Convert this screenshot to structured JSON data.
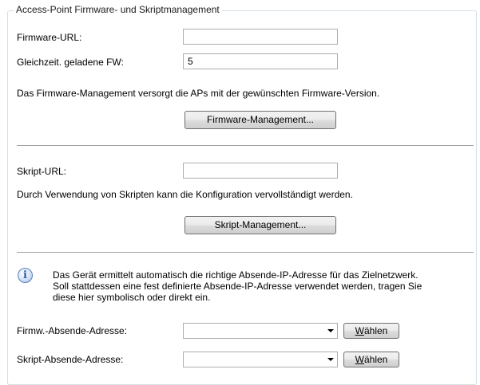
{
  "group": {
    "title": "Access-Point Firmware- und Skriptmanagement"
  },
  "firmware": {
    "url_label": "Firmware-URL:",
    "url_value": "",
    "concurrent_label": "Gleichzeit. geladene FW:",
    "concurrent_value": "5",
    "description": "Das Firmware-Management versorgt die APs mit der gewünschten Firmware-Version.",
    "button_label": "Firmware-Management..."
  },
  "script": {
    "url_label": "Skript-URL:",
    "url_value": "",
    "description": "Durch Verwendung von Skripten kann die Konfiguration vervollständigt werden.",
    "button_label": "Skript-Management..."
  },
  "info": {
    "icon": "info-icon",
    "lines": [
      "Das Gerät ermittelt automatisch die richtige Absende-IP-Adresse für das Zielnetzwerk.",
      "Soll stattdessen eine fest definierte Absende-IP-Adresse verwendet werden, tragen Sie",
      "diese hier symbolisch oder direkt ein."
    ]
  },
  "sender": {
    "firmware_label": "Firmw.-Absende-Adresse:",
    "firmware_value": "",
    "script_label": "Skript-Absende-Adresse:",
    "script_value": "",
    "choose_first": "W",
    "choose_rest": "ählen"
  }
}
